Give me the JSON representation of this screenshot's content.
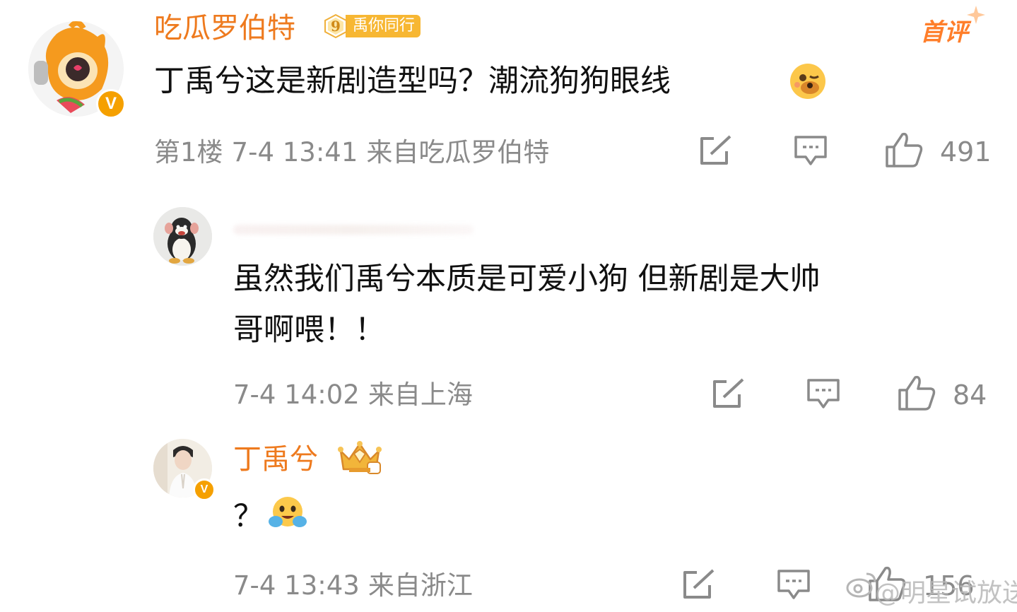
{
  "comments": [
    {
      "username": "吃瓜罗伯特",
      "fan_badge": {
        "level": "9",
        "label": "禹你同行"
      },
      "first_comment_tag": "首评",
      "text": "丁禹兮这是新剧造型吗？潮流狗狗眼线",
      "floor": "第1楼",
      "time": "7-4 13:41",
      "source": "来自吃瓜罗伯特",
      "likes": "491"
    },
    {
      "username": "",
      "text_line1": "虽然我们禹兮本质是可爱小狗 但新剧是大帅",
      "text_line2": "哥啊喂！！",
      "time": "7-4 14:02",
      "source": "来自上海",
      "likes": "84"
    },
    {
      "username": "丁禹兮",
      "text": "？",
      "time": "7-4 13:43",
      "source": "来自浙江",
      "likes": "156"
    }
  ],
  "watermark": "@明星试放送",
  "colors": {
    "username": "#ee7a1e",
    "meta": "#8a8a8a",
    "badge": "#f7b733",
    "verified": "#f5a000"
  },
  "icons": [
    "share-icon",
    "comment-icon",
    "like-icon"
  ]
}
